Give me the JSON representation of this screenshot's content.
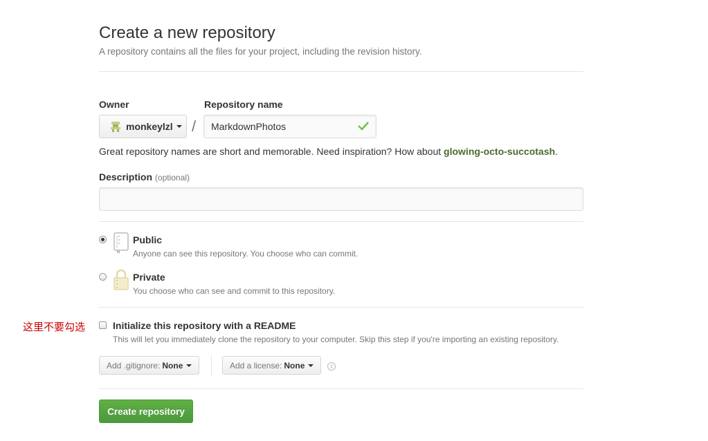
{
  "header": {
    "title": "Create a new repository",
    "subtitle": "A repository contains all the files for your project, including the revision history."
  },
  "owner": {
    "label": "Owner",
    "value": "monkeylzl"
  },
  "repo_name": {
    "label": "Repository name",
    "value": "MarkdownPhotos",
    "separator": "/"
  },
  "suggestion": {
    "text": "Great repository names are short and memorable. Need inspiration? How about ",
    "name": "glowing-octo-succotash",
    "end": "."
  },
  "description": {
    "label": "Description",
    "optional": "(optional)",
    "value": ""
  },
  "visibility": {
    "public_title": "Public",
    "public_desc": "Anyone can see this repository. You choose who can commit.",
    "private_title": "Private",
    "private_desc": "You choose who can see and commit to this repository.",
    "selected": "public"
  },
  "readme": {
    "label": "Initialize this repository with a README",
    "desc": "This will let you immediately clone the repository to your computer. Skip this step if you're importing an existing repository.",
    "checked": false
  },
  "annotation": "这里不要勾选",
  "gitignore": {
    "prefix": "Add .gitignore:",
    "value": "None"
  },
  "license": {
    "prefix": "Add a license:",
    "value": "None"
  },
  "submit_label": "Create repository",
  "colors": {
    "accent_green": "#55a532",
    "check_green": "#6cc644",
    "note_red": "#cc0000"
  }
}
